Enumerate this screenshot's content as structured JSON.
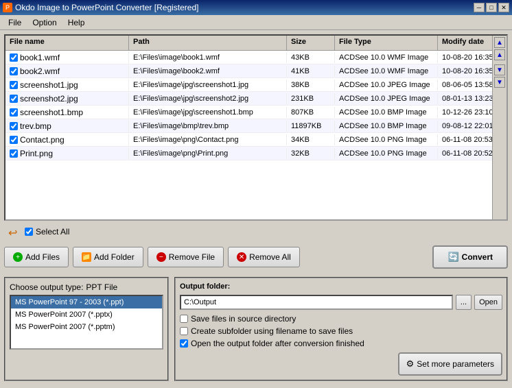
{
  "titlebar": {
    "title": "Okdo Image to PowerPoint Converter [Registered]",
    "btn_min": "─",
    "btn_max": "□",
    "btn_close": "✕"
  },
  "menubar": {
    "items": [
      "File",
      "Option",
      "Help"
    ]
  },
  "table": {
    "headers": [
      "File name",
      "Path",
      "Size",
      "File Type",
      "Modify date"
    ],
    "rows": [
      {
        "name": "book1.wmf",
        "path": "E:\\Files\\image\\book1.wmf",
        "size": "43KB",
        "type": "ACDSee 10.0 WMF Image",
        "date": "10-08-20 16:35"
      },
      {
        "name": "book2.wmf",
        "path": "E:\\Files\\image\\book2.wmf",
        "size": "41KB",
        "type": "ACDSee 10.0 WMF Image",
        "date": "10-08-20 16:35"
      },
      {
        "name": "screenshot1.jpg",
        "path": "E:\\Files\\image\\jpg\\screenshot1.jpg",
        "size": "38KB",
        "type": "ACDSee 10.0 JPEG Image",
        "date": "08-06-05 13:58"
      },
      {
        "name": "screenshot2.jpg",
        "path": "E:\\Files\\image\\jpg\\screenshot2.jpg",
        "size": "231KB",
        "type": "ACDSee 10.0 JPEG Image",
        "date": "08-01-13 13:23"
      },
      {
        "name": "screenshot1.bmp",
        "path": "E:\\Files\\image\\jpg\\screenshot1.bmp",
        "size": "807KB",
        "type": "ACDSee 10.0 BMP Image",
        "date": "10-12-26 23:10"
      },
      {
        "name": "trev.bmp",
        "path": "E:\\Files\\image\\bmp\\trev.bmp",
        "size": "11897KB",
        "type": "ACDSee 10.0 BMP Image",
        "date": "09-08-12 22:01"
      },
      {
        "name": "Contact.png",
        "path": "E:\\Files\\image\\png\\Contact.png",
        "size": "34KB",
        "type": "ACDSee 10.0 PNG Image",
        "date": "06-11-08 20:53"
      },
      {
        "name": "Print.png",
        "path": "E:\\Files\\image\\png\\Print.png",
        "size": "32KB",
        "type": "ACDSee 10.0 PNG Image",
        "date": "06-11-08 20:52"
      }
    ]
  },
  "select_all_label": "Select All",
  "buttons": {
    "add_files": "Add Files",
    "add_folder": "Add Folder",
    "remove_file": "Remove File",
    "remove_all": "Remove All",
    "convert": "Convert"
  },
  "output_type": {
    "label": "Choose output type:",
    "type_label": "PPT File",
    "options": [
      "MS PowerPoint 97 - 2003 (*.ppt)",
      "MS PowerPoint 2007 (*.pptx)",
      "MS PowerPoint 2007 (*.pptm)"
    ],
    "selected": 0
  },
  "output_folder": {
    "label": "Output folder:",
    "path": "C:\\Output",
    "browse_btn": "...",
    "open_btn": "Open",
    "checkboxes": [
      {
        "label": "Save files in source directory",
        "checked": false
      },
      {
        "label": "Create subfolder using filename to save files",
        "checked": false
      },
      {
        "label": "Open the output folder after conversion finished",
        "checked": true
      }
    ],
    "set_params_btn": "Set more parameters"
  }
}
